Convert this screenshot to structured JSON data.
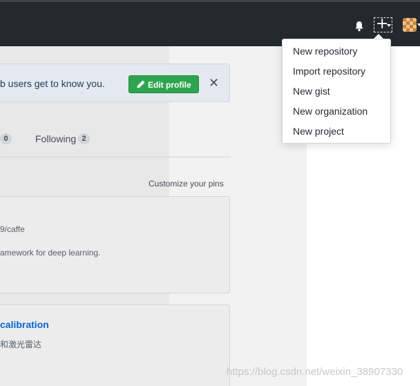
{
  "header": {
    "bell_icon": "bell-icon",
    "plus_icon": "plus-icon",
    "create_menu_caret": "caret-down-icon",
    "avatar": "user-avatar"
  },
  "create_menu": {
    "items": [
      {
        "label": "New repository"
      },
      {
        "label": "Import repository"
      },
      {
        "label": "New gist"
      },
      {
        "label": "New organization"
      },
      {
        "label": "New project"
      }
    ]
  },
  "banner": {
    "text": "b users get to know you.",
    "edit_label": "Edit profile",
    "edit_icon": "pencil-icon",
    "close_glyph": "✕"
  },
  "stats": {
    "followers_count": "0",
    "following_label": "Following",
    "following_count": "2"
  },
  "pinned": {
    "customize_label": "Customize your pins",
    "cards": [
      {
        "line1": "9/caffe",
        "line2": "amework for deep learning."
      },
      {
        "title": "calibration",
        "line1": "和激光雷达"
      }
    ]
  },
  "watermark": "https://blog.csdn.net/weixin_38907330",
  "colors": {
    "header_bg": "#24292e",
    "edit_button": "#2ea44f",
    "link": "#0366d6",
    "banner_bg": "#e4e9ef"
  }
}
